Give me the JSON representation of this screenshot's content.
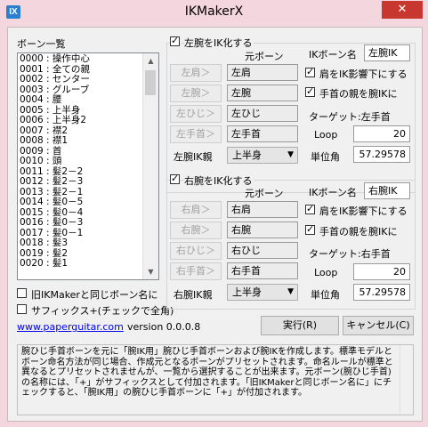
{
  "window": {
    "title": "IKMakerX",
    "icon_text": "IX",
    "close": "✕"
  },
  "bone_list": {
    "label": "ボーン一覧",
    "items": [
      "0000 : 操作中心",
      "0001 : 全ての親",
      "0002 : センター",
      "0003 : グルーブ",
      "0004 : 腰",
      "0005 : 上半身",
      "0006 : 上半身2",
      "0007 : 襟2",
      "0008 : 襟1",
      "0009 : 首",
      "0010 : 頭",
      "0011 : 髪2－2",
      "0012 : 髪2－3",
      "0013 : 髪2－1",
      "0014 : 髪0－5",
      "0015 : 髪0－4",
      "0016 : 髪0－3",
      "0017 : 髪0－1",
      "0018 : 髪3",
      "0019 : 髪2",
      "0020 : 髪1"
    ]
  },
  "options": {
    "old_name": "旧IKMakerと同じボーン名に",
    "suffix": "サフィックス+(チェックで全角)"
  },
  "footer": {
    "link": "www.paperguitar.com",
    "version": "version 0.0.0.8",
    "run": "実行(R)",
    "cancel": "キャンセル(C)"
  },
  "left": {
    "enable": "左腕をIK化する",
    "source_header": "元ボーン",
    "ik_name_label": "IKボーン名",
    "ik_name_value": "左腕IK",
    "rows": [
      {
        "button": "左肩＞",
        "value": "左肩"
      },
      {
        "button": "左腕＞",
        "value": "左腕"
      },
      {
        "button": "左ひじ＞",
        "value": "左ひじ"
      },
      {
        "button": "左手首＞",
        "value": "左手首"
      }
    ],
    "opt_shoulder": "肩をIK影響下にする",
    "opt_wrist_parent": "手首の親を腕IKに",
    "target": "ターゲット:左手首",
    "loop_label": "Loop",
    "loop_value": "20",
    "unit_label": "単位角",
    "unit_value": "57.29578",
    "parent_label": "左腕IK親",
    "parent_value": "上半身"
  },
  "right": {
    "enable": "右腕をIK化する",
    "source_header": "元ボーン",
    "ik_name_label": "IKボーン名",
    "ik_name_value": "右腕IK",
    "rows": [
      {
        "button": "右肩＞",
        "value": "右肩"
      },
      {
        "button": "右腕＞",
        "value": "右腕"
      },
      {
        "button": "右ひじ＞",
        "value": "右ひじ"
      },
      {
        "button": "右手首＞",
        "value": "右手首"
      }
    ],
    "opt_shoulder": "肩をIK影響下にする",
    "opt_wrist_parent": "手首の親を腕IKに",
    "target": "ターゲット:右手首",
    "loop_label": "Loop",
    "loop_value": "20",
    "unit_label": "単位角",
    "unit_value": "57.29578",
    "parent_label": "右腕IK親",
    "parent_value": "上半身"
  },
  "description": "腕ひじ手首ボーンを元に「腕IK用」腕ひじ手首ボーンおよび腕IKを作成します。標準モデルとボーン命名方法が同じ場合、作成元となるボーンがプリセットされます。命名ルールが標準と異なるとプリセットされませんが、一覧から選択することが出来ます。元ボーン(腕ひじ手首)の名称には、「+」がサフィックスとして付加されます。「旧IKMakerと同じボーン名に」にチェックすると、「腕IK用」の腕ひじ手首ボーンに「+」が付加されます。"
}
